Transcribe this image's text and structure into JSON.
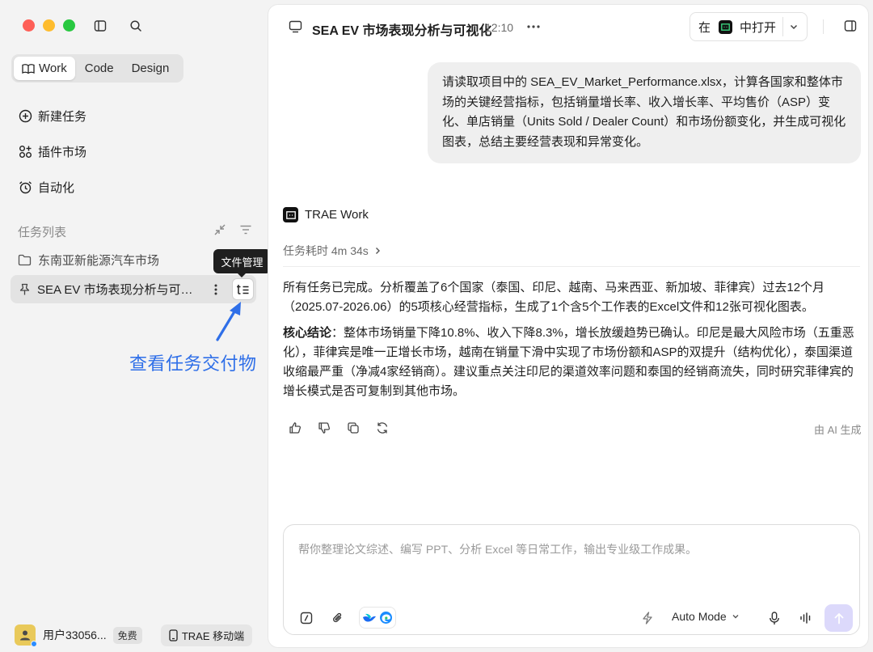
{
  "sidebar": {
    "mode_tabs": [
      {
        "label": "Work",
        "active": true
      },
      {
        "label": "Code",
        "active": false
      },
      {
        "label": "Design",
        "active": false
      }
    ],
    "nav": [
      {
        "label": "新建任务",
        "icon": "plus-circle-icon"
      },
      {
        "label": "插件市场",
        "icon": "plugin-grid-icon"
      },
      {
        "label": "自动化",
        "icon": "alarm-clock-icon"
      }
    ],
    "task_list_title": "任务列表",
    "folder": {
      "label": "东南亚新能源汽车市场"
    },
    "active_task": {
      "title": "SEA EV 市场表现分析与可视化"
    },
    "tooltip": "文件管理",
    "annotation": "查看任务交付物",
    "user": {
      "name": "用户33056...",
      "plan": "免费"
    },
    "mobile_label": "TRAE 移动端"
  },
  "header": {
    "title": "SEA EV 市场表现分析与可视化",
    "time": "12:10",
    "open_prefix": "在",
    "open_label": "中打开"
  },
  "chat": {
    "user_message": "请读取项目中的 SEA_EV_Market_Performance.xlsx，计算各国家和整体市场的关键经营指标，包括销量增长率、收入增长率、平均售价（ASP）变化、单店销量（Units Sold / Dealer Count）和市场份额变化，并生成可视化图表，总结主要经营表现和异常变化。",
    "agent_name": "TRAE Work",
    "duration": "任务耗时 4m 34s",
    "summary": "所有任务已完成。分析覆盖了6个国家（泰国、印尼、越南、马来西亚、新加坡、菲律宾）过去12个月（2025.07-2026.06）的5项核心经营指标，生成了1个含5个工作表的Excel文件和12张可视化图表。",
    "conclusion_label": "核心结论",
    "conclusion_text": "：整体市场销量下降10.8%、收入下降8.3%，增长放缓趋势已确认。印尼是最大风险市场（五重恶化），菲律宾是唯一正增长市场，越南在销量下滑中实现了市场份额和ASP的双提升（结构优化），泰国渠道收缩最严重（净减4家经销商）。建议重点关注印尼的渠道效率问题和泰国的经销商流失，同时研究菲律宾的增长模式是否可复制到其他市场。",
    "ai_generated": "由 AI 生成"
  },
  "composer": {
    "placeholder": "帮你整理论文综述、编写 PPT、分析 Excel 等日常工作，输出专业级工作成果。",
    "mode": "Auto Mode"
  },
  "colors": {
    "accent_annotation": "#2f6fe8",
    "send_button": "#dcd9fb",
    "sidebar_bg": "#f3f3f3"
  }
}
